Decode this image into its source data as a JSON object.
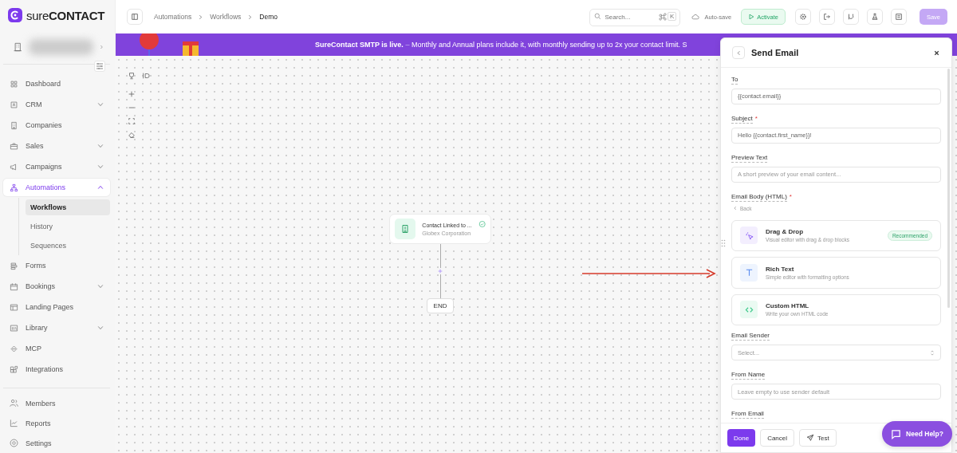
{
  "brand": {
    "prefix": "sure",
    "name": "CONTACT"
  },
  "sidebar": {
    "items": [
      {
        "kind": "link",
        "label": "Dashboard",
        "selected": false
      },
      {
        "kind": "group",
        "label": "CRM",
        "expanded": false,
        "selected": false
      },
      {
        "kind": "link",
        "label": "Companies",
        "selected": false
      },
      {
        "kind": "group",
        "label": "Sales",
        "expanded": false,
        "selected": false
      },
      {
        "kind": "group",
        "label": "Campaigns",
        "expanded": false,
        "selected": false
      },
      {
        "kind": "group",
        "label": "Automations",
        "expanded": true,
        "selected": true,
        "children": [
          {
            "label": "Workflows",
            "selected": true
          },
          {
            "label": "History",
            "selected": false
          },
          {
            "label": "Sequences",
            "selected": false
          }
        ]
      },
      {
        "kind": "link",
        "label": "Forms",
        "selected": false
      },
      {
        "kind": "group",
        "label": "Bookings",
        "expanded": false,
        "selected": false
      },
      {
        "kind": "link",
        "label": "Landing Pages",
        "selected": false
      },
      {
        "kind": "group",
        "label": "Library",
        "expanded": false,
        "selected": false
      },
      {
        "kind": "link",
        "label": "MCP",
        "selected": false
      },
      {
        "kind": "link",
        "label": "Integrations",
        "selected": false
      }
    ],
    "bottom_items": [
      {
        "label": "Members"
      },
      {
        "label": "Reports"
      },
      {
        "label": "Settings"
      }
    ]
  },
  "breadcrumb": [
    "Automations",
    "Workflows",
    "Demo"
  ],
  "toolbar": {
    "search": {
      "placeholder": "Search...",
      "shortcut_key": "K"
    },
    "autosave": "Auto-save",
    "activate": "Activate",
    "save": "Save"
  },
  "banner": {
    "headline": "SureContact SMTP is live.",
    "separator": "–",
    "text": "Monthly and Annual plans include it, with monthly sending up to 2x your contact limit. S"
  },
  "workflow": {
    "node": {
      "title": "Contact Linked to ...",
      "subtitle": "Globex Corporation"
    },
    "end": "END"
  },
  "panel": {
    "title": "Send Email",
    "fields": [
      {
        "kind": "input",
        "label": "To",
        "value": "{{contact.email}}"
      },
      {
        "kind": "input",
        "label": "Subject",
        "required_mark": "*",
        "value": "Hello {{contact.first_name}}!"
      },
      {
        "kind": "input",
        "label": "Preview Text",
        "placeholder": "A short preview of your email content..."
      },
      {
        "kind": "chooser",
        "label": "Email Body (HTML)",
        "required_mark": "*",
        "back": "Back",
        "options": [
          {
            "title": "Drag & Drop",
            "description": "Visual editor with drag & drop blocks",
            "badge": "Recommended"
          },
          {
            "title": "Rich Text",
            "description": "Simple editor with formatting options"
          },
          {
            "title": "Custom HTML",
            "description": "Write your own HTML code"
          }
        ]
      },
      {
        "kind": "select",
        "label": "Email Sender",
        "placeholder": "Select..."
      },
      {
        "kind": "input",
        "label": "From Name",
        "placeholder": "Leave empty to use sender default"
      },
      {
        "kind": "label",
        "label": "From Email"
      }
    ],
    "buttons": {
      "done": "Done",
      "cancel": "Cancel",
      "test": "Test"
    }
  },
  "help_button": "Need Help?"
}
